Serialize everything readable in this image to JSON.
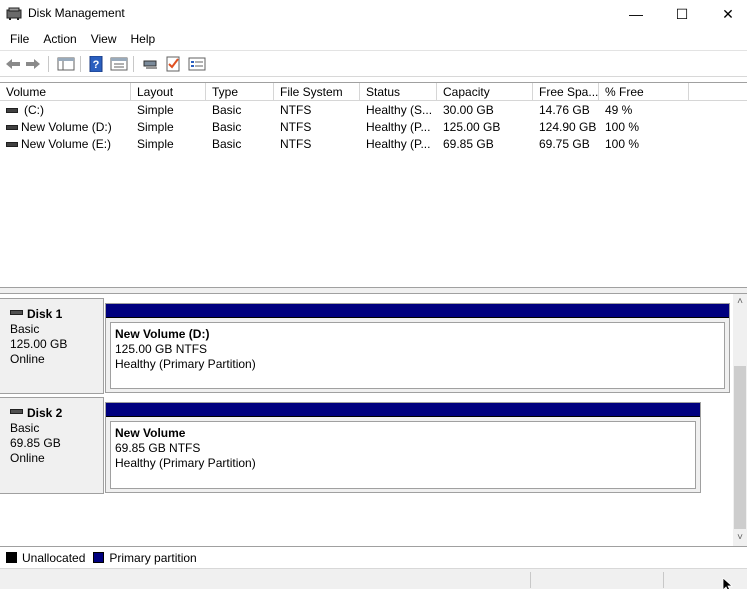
{
  "window": {
    "title": "Disk Management",
    "minimize_glyph": "—",
    "maximize_glyph": "☐",
    "close_glyph": "✕"
  },
  "menu": [
    "File",
    "Action",
    "View",
    "Help"
  ],
  "toolbar": {
    "icons": [
      "back-icon",
      "forward-icon",
      "console-tree-icon",
      "help-icon",
      "properties-icon",
      "connect-icon",
      "check-icon",
      "list-view-icon"
    ]
  },
  "volume_list": {
    "columns": [
      "Volume",
      "Layout",
      "Type",
      "File System",
      "Status",
      "Capacity",
      "Free Spa...",
      "% Free"
    ],
    "rows": [
      [
        "(C:)",
        "Simple",
        "Basic",
        "NTFS",
        "Healthy (S...",
        "30.00 GB",
        "14.76 GB",
        "49 %"
      ],
      [
        "New Volume (D:)",
        "Simple",
        "Basic",
        "NTFS",
        "Healthy (P...",
        "125.00 GB",
        "124.90 GB",
        "100 %"
      ],
      [
        "New Volume (E:)",
        "Simple",
        "Basic",
        "NTFS",
        "Healthy (P...",
        "69.85 GB",
        "69.75 GB",
        "100 %"
      ]
    ]
  },
  "disks": [
    {
      "name": "Disk 1",
      "type": "Basic",
      "size": "125.00 GB",
      "state": "Online",
      "partition": {
        "name": "New Volume  (D:)",
        "fs": "125.00 GB NTFS",
        "status": "Healthy (Primary Partition)"
      }
    },
    {
      "name": "Disk 2",
      "type": "Basic",
      "size": "69.85 GB",
      "state": "Online",
      "partition": {
        "name": "New Volume",
        "fs": "69.85 GB NTFS",
        "status": "Healthy (Primary Partition)"
      }
    }
  ],
  "legend": [
    {
      "label": "Unallocated",
      "color": "#000000"
    },
    {
      "label": "Primary partition",
      "color": "#00007f"
    }
  ],
  "scroll": {
    "up_glyph": "˄",
    "down_glyph": "˅"
  }
}
